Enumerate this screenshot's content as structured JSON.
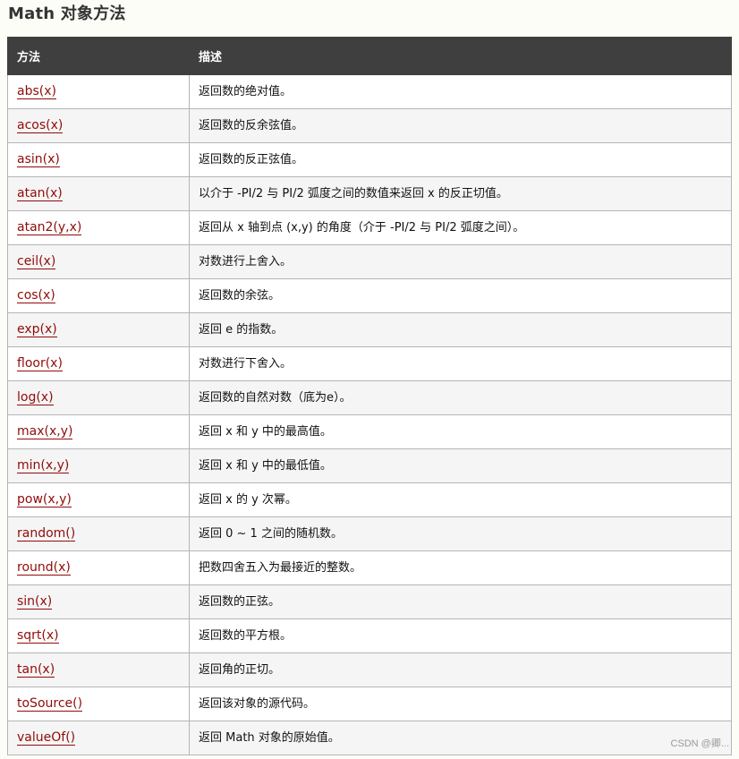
{
  "title": "Math 对象方法",
  "table": {
    "headers": [
      "方法",
      "描述"
    ],
    "rows": [
      {
        "method": "abs(x)",
        "description": "返回数的绝对值。"
      },
      {
        "method": "acos(x)",
        "description": "返回数的反余弦值。"
      },
      {
        "method": "asin(x)",
        "description": "返回数的反正弦值。"
      },
      {
        "method": "atan(x)",
        "description": "以介于 -PI/2 与 PI/2 弧度之间的数值来返回 x 的反正切值。"
      },
      {
        "method": "atan2(y,x)",
        "description": "返回从 x 轴到点 (x,y) 的角度（介于 -PI/2 与 PI/2 弧度之间）。"
      },
      {
        "method": "ceil(x)",
        "description": "对数进行上舍入。"
      },
      {
        "method": "cos(x)",
        "description": "返回数的余弦。"
      },
      {
        "method": "exp(x)",
        "description": "返回 e 的指数。"
      },
      {
        "method": "floor(x)",
        "description": "对数进行下舍入。"
      },
      {
        "method": "log(x)",
        "description": "返回数的自然对数（底为e）。"
      },
      {
        "method": "max(x,y)",
        "description": "返回 x 和 y 中的最高值。"
      },
      {
        "method": "min(x,y)",
        "description": "返回 x 和 y 中的最低值。"
      },
      {
        "method": "pow(x,y)",
        "description": "返回 x 的 y 次幂。"
      },
      {
        "method": "random()",
        "description": "返回 0 ~ 1 之间的随机数。"
      },
      {
        "method": "round(x)",
        "description": "把数四舍五入为最接近的整数。"
      },
      {
        "method": "sin(x)",
        "description": "返回数的正弦。"
      },
      {
        "method": "sqrt(x)",
        "description": "返回数的平方根。"
      },
      {
        "method": "tan(x)",
        "description": "返回角的正切。"
      },
      {
        "method": "toSource()",
        "description": "返回该对象的源代码。"
      },
      {
        "method": "valueOf()",
        "description": "返回 Math 对象的原始值。"
      }
    ]
  },
  "watermark": "CSDN @卿...",
  "colors": {
    "header_bg": "#3f3f3f",
    "link": "#900b09",
    "row_alt": "#f5f5f5",
    "border": "#b5b5b5"
  }
}
